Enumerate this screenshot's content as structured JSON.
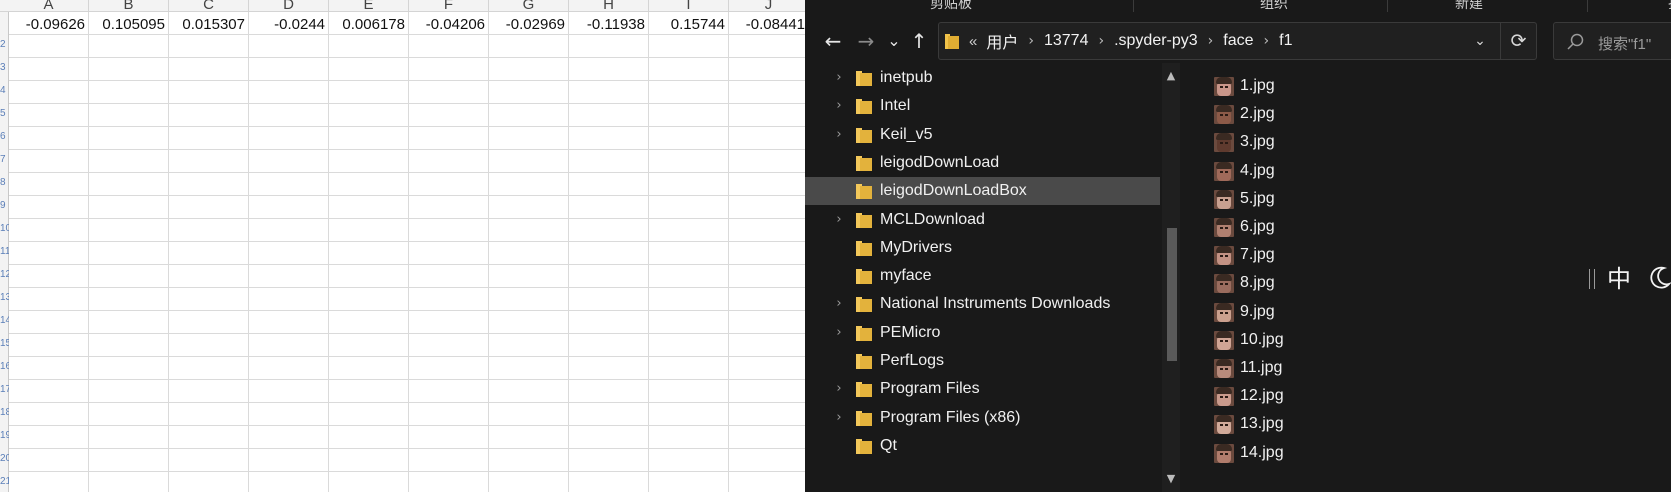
{
  "sheet": {
    "columns": [
      "A",
      "B",
      "C",
      "D",
      "E",
      "F",
      "G",
      "H",
      "I",
      "J"
    ],
    "row1_values": [
      "-0.09626",
      "0.105095",
      "0.015307",
      "-0.0244",
      "0.006178",
      "-0.04206",
      "-0.02969",
      "-0.11938",
      "0.15744",
      "-0.08441"
    ],
    "row_numbers": [
      "2",
      "3",
      "4",
      "5",
      "6",
      "7",
      "8",
      "9",
      "10",
      "11",
      "12",
      "13",
      "14",
      "15",
      "16",
      "17",
      "18",
      "19",
      "20",
      "21"
    ]
  },
  "explorer": {
    "ribbon": [
      "剪贴板",
      "组织",
      "新建",
      "打开"
    ],
    "nav": {
      "back": "←",
      "forward": "→",
      "recent": "⌄",
      "up": "↑"
    },
    "breadcrumb": {
      "overflow": "«",
      "items": [
        "用户",
        "13774",
        ".spyder-py3",
        "face",
        "f1"
      ]
    },
    "search_placeholder": "搜索\"f1\"",
    "tree": [
      {
        "label": "inetpub",
        "expandable": true,
        "selected": false
      },
      {
        "label": "Intel",
        "expandable": true,
        "selected": false
      },
      {
        "label": "Keil_v5",
        "expandable": true,
        "selected": false
      },
      {
        "label": "leigodDownLoad",
        "expandable": false,
        "selected": false
      },
      {
        "label": "leigodDownLoadBox",
        "expandable": false,
        "selected": true
      },
      {
        "label": "MCLDownload",
        "expandable": true,
        "selected": false
      },
      {
        "label": "MyDrivers",
        "expandable": false,
        "selected": false
      },
      {
        "label": "myface",
        "expandable": false,
        "selected": false
      },
      {
        "label": "National Instruments Downloads",
        "expandable": true,
        "selected": false
      },
      {
        "label": "PEMicro",
        "expandable": true,
        "selected": false
      },
      {
        "label": "PerfLogs",
        "expandable": false,
        "selected": false
      },
      {
        "label": "Program Files",
        "expandable": true,
        "selected": false
      },
      {
        "label": "Program Files (x86)",
        "expandable": true,
        "selected": false
      },
      {
        "label": "Qt",
        "expandable": false,
        "selected": false
      }
    ],
    "files": [
      "1.jpg",
      "2.jpg",
      "3.jpg",
      "4.jpg",
      "5.jpg",
      "6.jpg",
      "7.jpg",
      "8.jpg",
      "9.jpg",
      "10.jpg",
      "11.jpg",
      "12.jpg",
      "13.jpg",
      "14.jpg"
    ],
    "thumb_colors": [
      "#c9968a",
      "#8c5a48",
      "#5e3a2e",
      "#a06a5a",
      "#c8a090",
      "#b08070",
      "#c39284",
      "#9a6c5e",
      "#caa08e",
      "#d0a595",
      "#b78b7c",
      "#c99a8c",
      "#d1aa9a",
      "#b07c6c"
    ]
  },
  "ime": {
    "mode": "中"
  },
  "colors": {
    "folder": "#e8c35a",
    "explorer_bg": "#191919",
    "selected_row": "#4a4a4a"
  }
}
